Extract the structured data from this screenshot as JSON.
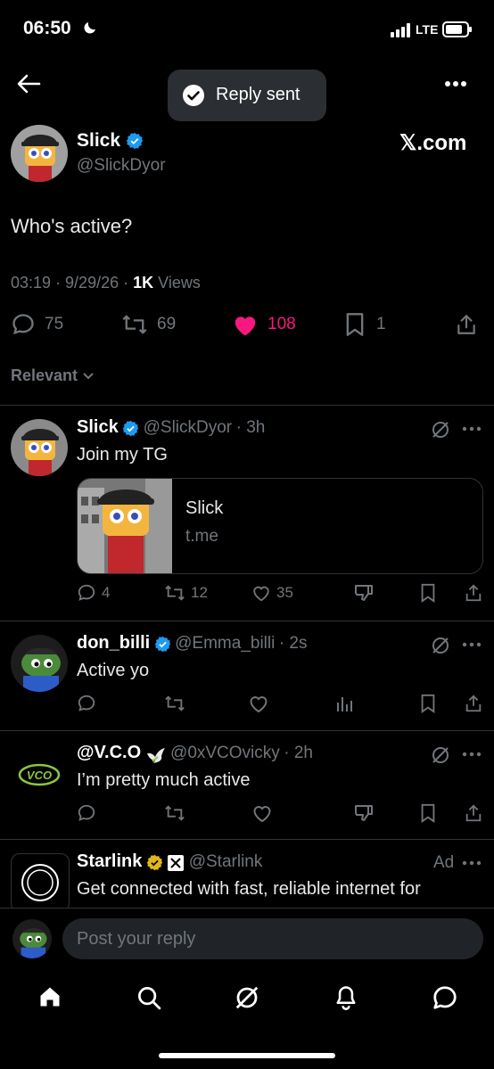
{
  "status": {
    "time": "06:50",
    "network": "LTE"
  },
  "toast": {
    "text": "Reply sent"
  },
  "brand": {
    "site": "𝕏.com"
  },
  "colors": {
    "like": "#f91880",
    "verified": "#1d9bf0",
    "gold": "#e2b719",
    "muted": "#71767b"
  },
  "post": {
    "name": "Slick",
    "handle": "@SlickDyor",
    "text": "Who's active?",
    "time": "03:19 · 9/29/26 ·",
    "views_count": "1K",
    "views_label": "Views",
    "replies": "75",
    "reposts": "69",
    "likes": "108",
    "bookmarks": "1"
  },
  "sort": {
    "label": "Relevant"
  },
  "replies": [
    {
      "name": "Slick",
      "handle": "@SlickDyor",
      "age": "· 3h",
      "text": "Join my TG",
      "card": {
        "title": "Slick",
        "domain": "t.me"
      },
      "replies": "4",
      "reposts": "12",
      "likes": "35"
    },
    {
      "name": "don_billi",
      "handle": "@Emma_billi",
      "age": "· 2s",
      "text": "Active yo"
    },
    {
      "name": "@V.C.O",
      "handle": "@0xVCOvicky",
      "age": "· 2h",
      "text": "I’m pretty much active",
      "avatar_text": "VCO"
    },
    {
      "name": "Starlink",
      "handle": "@Starlink",
      "ad": "Ad",
      "text": "Get connected with fast, reliable internet for"
    }
  ],
  "composer": {
    "placeholder": "Post your reply"
  },
  "nav": [
    "home-icon",
    "search-icon",
    "grok-icon",
    "notifications-icon",
    "messages-icon"
  ]
}
